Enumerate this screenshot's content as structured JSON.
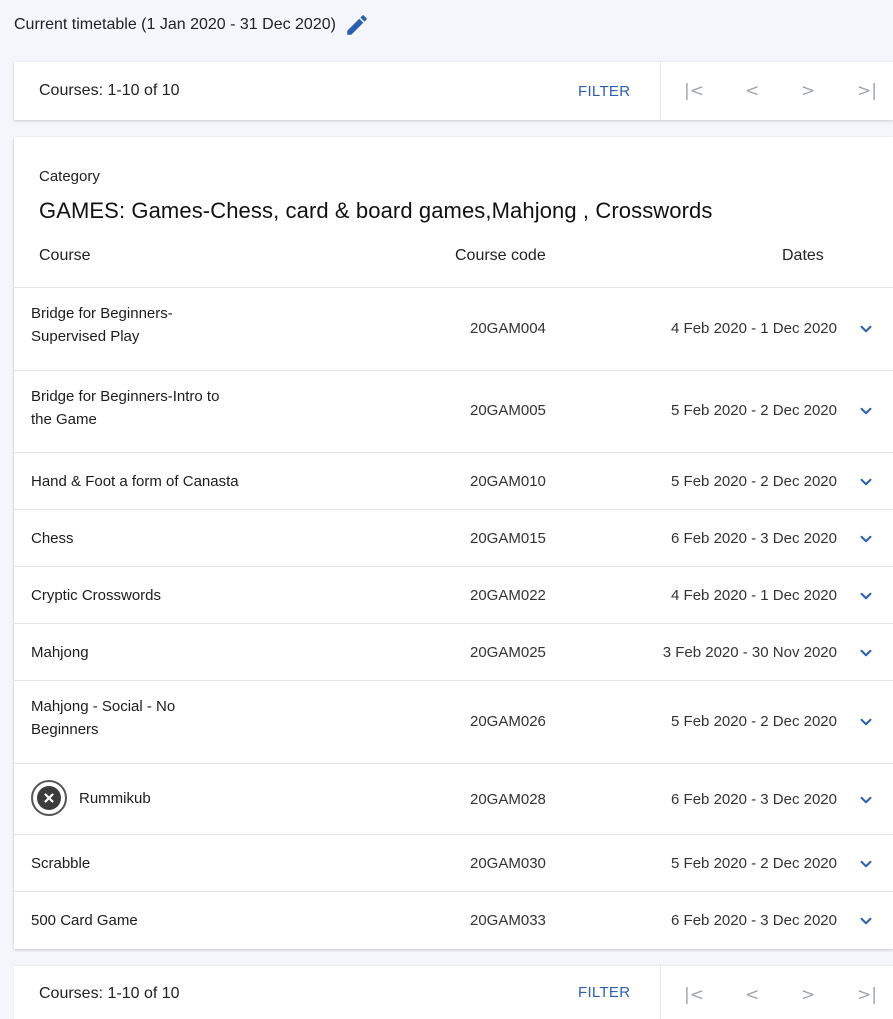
{
  "header": {
    "timetable_label": "Current timetable (1 Jan 2020 - 31 Dec 2020)",
    "edit_icon": "pencil-icon"
  },
  "pager": {
    "count_label": "Courses: 1-10 of 10",
    "filter_label": "FILTER",
    "first_glyph": "|<",
    "prev_glyph": "<",
    "next_glyph": ">",
    "last_glyph": ">|"
  },
  "category": {
    "label": "Category",
    "title": "GAMES: Games-Chess, card & board games,Mahjong , Crosswords"
  },
  "columns": {
    "course": "Course",
    "code": "Course code",
    "dates": "Dates"
  },
  "courses": [
    {
      "name_line1": "Bridge for Beginners-",
      "name_line2": "Supervised Play",
      "code": "20GAM004",
      "dates": "4 Feb 2020 - 1 Dec 2020"
    },
    {
      "name_line1": "Bridge for Beginners-Intro to",
      "name_line2": "the Game",
      "code": "20GAM005",
      "dates": "5 Feb 2020 - 2 Dec 2020"
    },
    {
      "name_line1": "Hand & Foot a form of Canasta",
      "name_line2": "",
      "code": "20GAM010",
      "dates": "5 Feb 2020 - 2 Dec 2020"
    },
    {
      "name_line1": "Chess",
      "name_line2": "",
      "code": "20GAM015",
      "dates": "6 Feb 2020 - 3 Dec 2020"
    },
    {
      "name_line1": "Cryptic Crosswords",
      "name_line2": "",
      "code": "20GAM022",
      "dates": "4 Feb 2020 - 1 Dec 2020"
    },
    {
      "name_line1": "Mahjong",
      "name_line2": "",
      "code": "20GAM025",
      "dates": "3 Feb 2020 - 30 Nov 2020"
    },
    {
      "name_line1": "Mahjong - Social - No",
      "name_line2": "Beginners",
      "code": "20GAM026",
      "dates": "5 Feb 2020 - 2 Dec 2020"
    },
    {
      "name_line1": "Rummikub",
      "name_line2": "",
      "code": "20GAM028",
      "dates": "6 Feb 2020 - 3 Dec 2020",
      "status_icon": "cancelled-icon"
    },
    {
      "name_line1": "Scrabble",
      "name_line2": "",
      "code": "20GAM030",
      "dates": "5 Feb 2020 - 2 Dec 2020"
    },
    {
      "name_line1": "500 Card Game",
      "name_line2": "",
      "code": "20GAM033",
      "dates": "6 Feb 2020 - 3 Dec 2020"
    }
  ],
  "colors": {
    "accent": "#2d5fb1",
    "background": "#f5f6fb"
  }
}
